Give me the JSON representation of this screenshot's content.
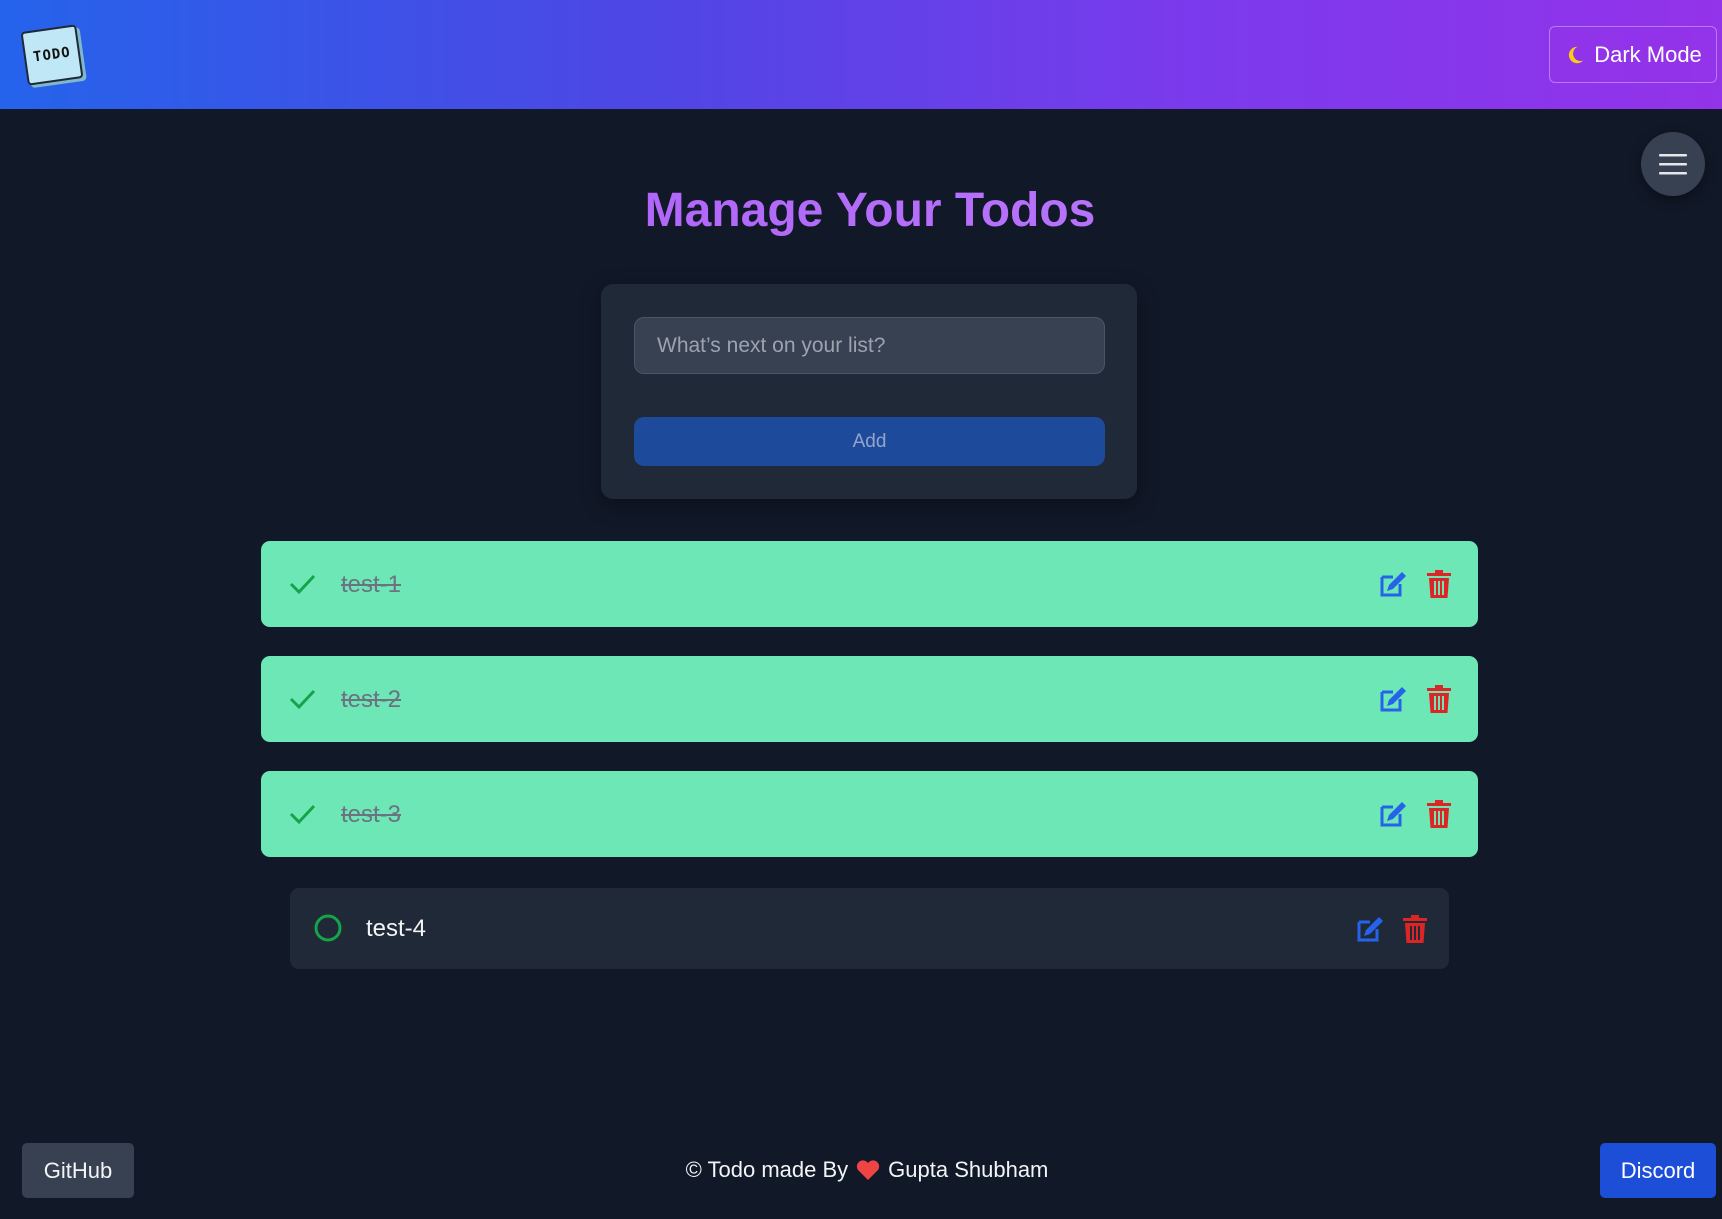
{
  "header": {
    "logo_text": "TODO",
    "dark_mode_label": "Dark Mode",
    "moon_icon": "moon-icon"
  },
  "menu": {
    "icon": "hamburger-menu-icon"
  },
  "main": {
    "title": "Manage Your Todos",
    "input_placeholder": "What’s next on your list?",
    "input_value": "",
    "add_label": "Add"
  },
  "todos": [
    {
      "text": "test-1",
      "completed": true
    },
    {
      "text": "test-2",
      "completed": true
    },
    {
      "text": "test-3",
      "completed": true
    },
    {
      "text": "test-4",
      "completed": false
    }
  ],
  "footer": {
    "github_label": "GitHub",
    "credit_prefix": "© Todo made By",
    "credit_author": "Gupta Shubham",
    "discord_label": "Discord"
  },
  "colors": {
    "done_bg": "#6ee7b7",
    "check": "#16a34a",
    "edit": "#2563eb",
    "delete": "#dc2626",
    "heart": "#ef4444"
  }
}
